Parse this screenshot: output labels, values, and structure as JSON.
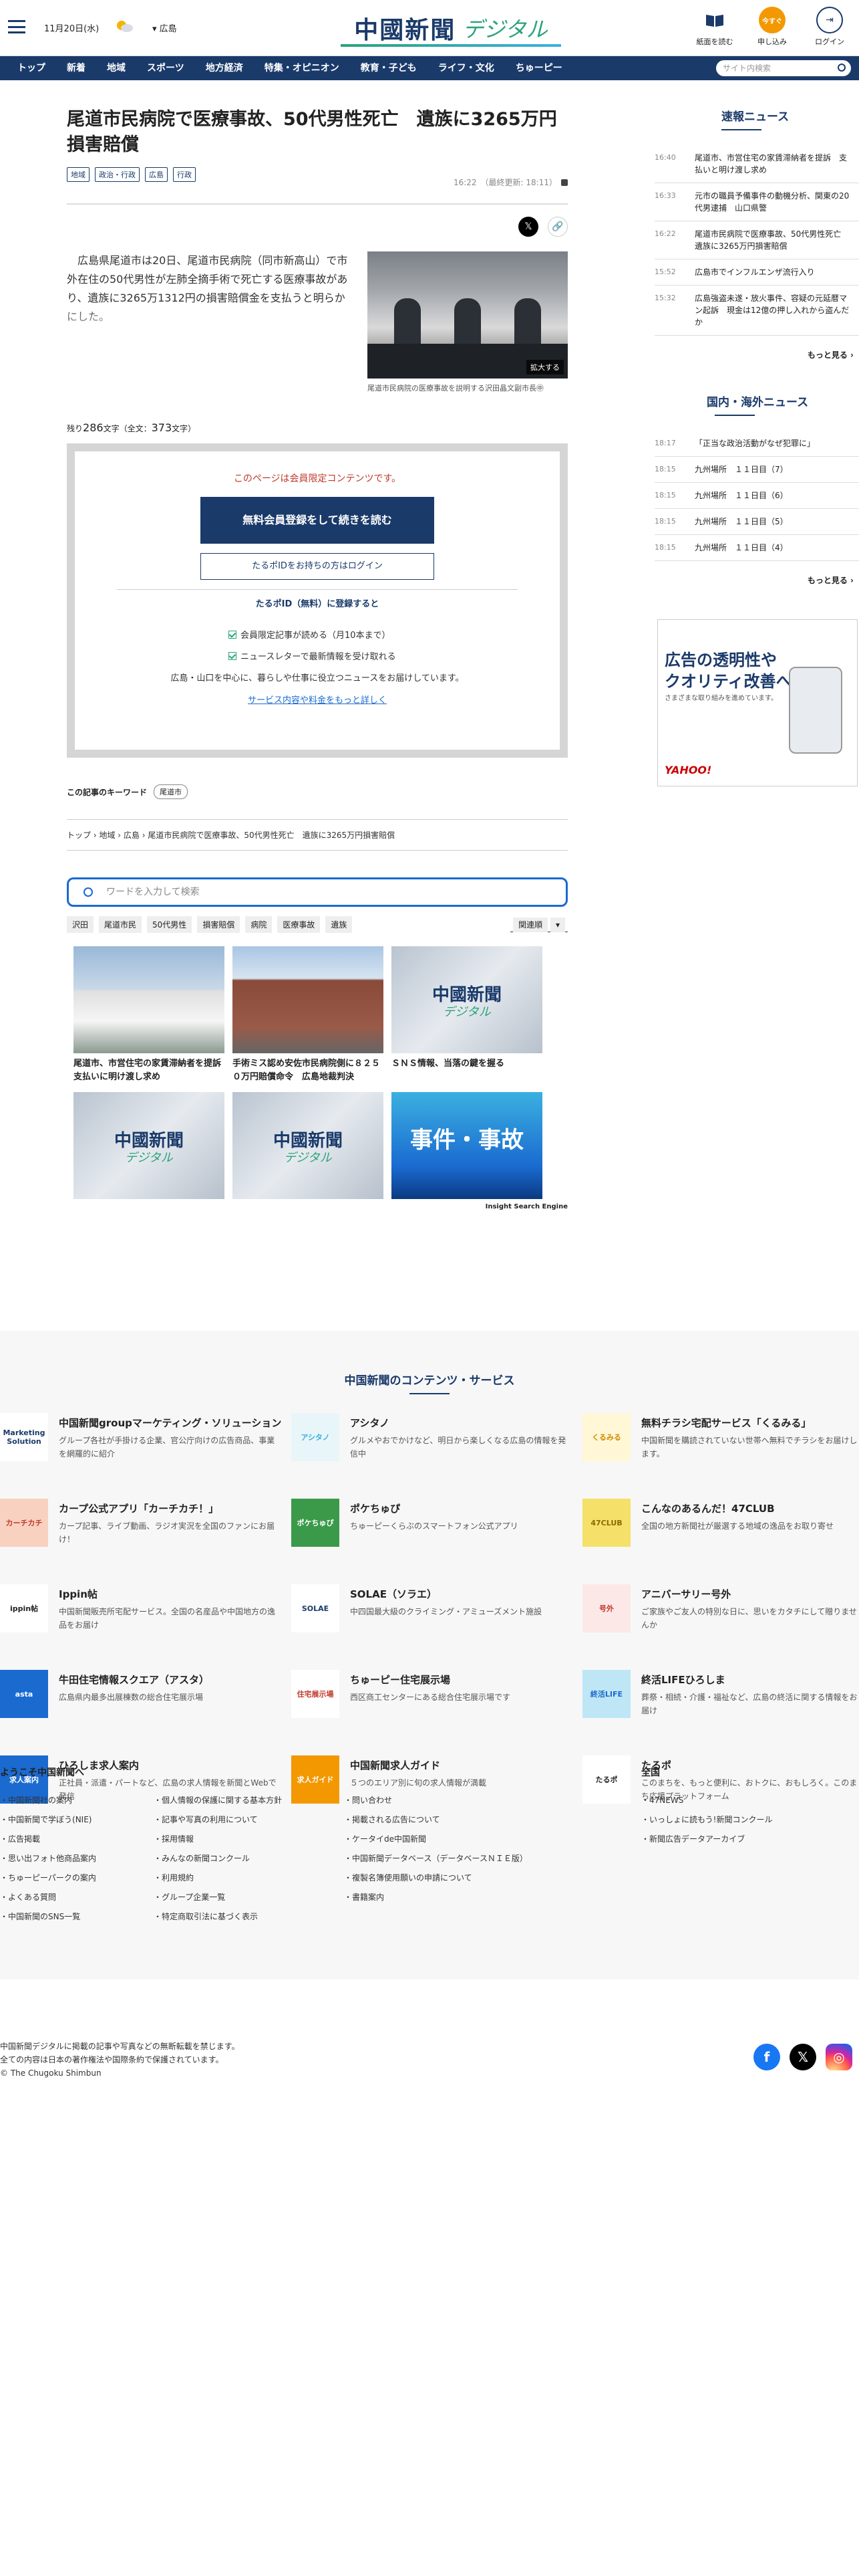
{
  "header": {
    "date": "11月20日(水)",
    "region": "広島",
    "logo_main": "中國新聞",
    "logo_sub": "デジタル",
    "buttons": [
      {
        "label": "紙面を読む",
        "icon": "newspaper-icon"
      },
      {
        "label": "申し込み",
        "icon": "apply-icon",
        "badge": "今すぐ"
      },
      {
        "label": "ログイン",
        "icon": "login-icon"
      }
    ]
  },
  "nav": {
    "items": [
      "トップ",
      "新着",
      "地域",
      "スポーツ",
      "地方経済",
      "特集・オピニオン",
      "教育・子ども",
      "ライフ・文化",
      "ちゅーピー"
    ],
    "search_placeholder": "サイト内検索"
  },
  "article": {
    "title": "尾道市民病院で医療事故、50代男性死亡　遺族に3265万円損害賠償",
    "tags": [
      "地域",
      "政治・行政",
      "広島",
      "行政"
    ],
    "time": "16:22",
    "updated": "（最終更新: 18:11）",
    "lead": "　広島県尾道市は20日、尾道市民病院（同市新高山）で市外在住の50代男性が左肺全摘手術で死亡する医療事故があり、遺族に3265万1312円の損害賠償金を支払うと明らかにした。",
    "photo_enlarge": "拡大する",
    "photo_caption": "尾道市民病院の医療事故を説明する沢田晶文副市長㊥",
    "remain_label": "残り",
    "remain_count": "286",
    "remain_unit": "文字（全文：",
    "total_count": "373",
    "total_unit": "文字）"
  },
  "paywall": {
    "notice": "このページは会員限定コンテンツです。",
    "register_button": "無料会員登録をして続きを読む",
    "login_button": "たるポIDをお持ちの方はログイン",
    "subtitle": "たるポID（無料）に登録すると",
    "benefits": [
      "会員限定記事が読める（月10本まで）",
      "ニュースレターで最新情報を受け取れる"
    ],
    "desc": "広島・山口を中心に、暮らしや仕事に役立つニュースをお届けしています。",
    "more_link": "サービス内容や料金をもっと詳しく"
  },
  "keywords": {
    "label": "この記事のキーワード",
    "items": [
      "尾道市"
    ]
  },
  "breadcrumb": [
    "トップ",
    "地域",
    "広島",
    "尾道市民病院で医療事故、50代男性死亡　遺族に3265万円損害賠償"
  ],
  "search": {
    "placeholder": "ワードを入力して検索",
    "keywords": [
      "沢田",
      "尾道市民",
      "50代男性",
      "損害賠償",
      "病院",
      "医療事故",
      "遺族"
    ],
    "sort": "関連順",
    "results": [
      {
        "title": "尾道市、市営住宅の家賃滞納者を提訴　支払いに明け渡し求め",
        "thumb": "building"
      },
      {
        "title": "手術ミス認め安佐市民病院側に８２５０万円賠償命令　広島地裁判決",
        "thumb": "hospital"
      },
      {
        "title": "ＳＮＳ情報、当落の鍵を握る",
        "thumb": "logo"
      },
      {
        "title": "",
        "thumb": "logo"
      },
      {
        "title": "",
        "thumb": "logo"
      },
      {
        "title": "",
        "thumb": "jiken"
      }
    ],
    "logo_main": "中國新聞",
    "logo_sub": "デジタル",
    "jiken": "事件・事故",
    "engine": "Insight Search Engine"
  },
  "sidebar": {
    "breaking": {
      "title": "速報ニュース",
      "items": [
        {
          "time": "16:40",
          "text": "尾道市、市営住宅の家賃滞納者を提訴　支払いと明け渡し求め"
        },
        {
          "time": "16:33",
          "text": "元市の職員予備事件の動機分析、関東の20代男逮捕　山口県警"
        },
        {
          "time": "16:22",
          "text": "尾道市民病院で医療事故、50代男性死亡　遺族に3265万円損害賠償"
        },
        {
          "time": "15:52",
          "text": "広島市でインフルエンザ流行入り"
        },
        {
          "time": "15:32",
          "text": "広島強盗未遂・放火事件、容疑の元延暦マン起訴　現金は12億の押し入れから盗んだか"
        }
      ],
      "more": "もっと見る ›"
    },
    "national": {
      "title": "国内・海外ニュース",
      "items": [
        {
          "time": "18:17",
          "text": "「正当な政治活動がなぜ犯罪に」"
        },
        {
          "time": "18:15",
          "text": "九州場所　１１日目（7）"
        },
        {
          "time": "18:15",
          "text": "九州場所　１１日目（6）"
        },
        {
          "time": "18:15",
          "text": "九州場所　１１日目（5）"
        },
        {
          "time": "18:15",
          "text": "九州場所　１１日目（4）"
        }
      ],
      "more": "もっと見る ›"
    },
    "ad": {
      "line1": "広告の透明性や",
      "line2": "クオリティ改善への",
      "line3": "さまざまな取り組みを進めています。",
      "brand": "YAHOO!"
    }
  },
  "services": {
    "title": "中国新聞のコンテンツ・サービス",
    "items": [
      {
        "name": "中国新聞groupマーケティング・ソリューション",
        "desc": "グループ各社が手掛ける企業、官公庁向けの広告商品、事業を網羅的に紹介",
        "icon": "Marketing Solution",
        "bg": "#ffffff",
        "fg": "#1a3a6a"
      },
      {
        "name": "アシタノ",
        "desc": "グルメやおでかけなど、明日から楽しくなる広島の情報を発信中",
        "icon": "アシタノ",
        "bg": "#e8f6fa",
        "fg": "#3bb0e0"
      },
      {
        "name": "無料チラシ宅配サービス「くるみる」",
        "desc": "中国新聞を購読されていない世帯へ無料でチラシをお届けします。",
        "icon": "くるみる",
        "bg": "#fff7d6",
        "fg": "#d08a00"
      },
      {
        "name": "カープ公式アプリ「カーチカチ！」",
        "desc": "カープ記事、ライブ動画、ラジオ実況を全国のファンにお届け！",
        "icon": "カーチカチ",
        "bg": "#f9d1c0",
        "fg": "#c0392b"
      },
      {
        "name": "ポケちゅぴ",
        "desc": "ちゅーピーくらぶのスマートフォン公式アプリ",
        "icon": "ポケちゅぴ",
        "bg": "#3a9a4a",
        "fg": "#ffffff"
      },
      {
        "name": "こんなのあるんだ！47CLUB",
        "desc": "全国の地方新聞社が厳選する地域の逸品をお取り寄せ",
        "icon": "47CLUB",
        "bg": "#f5e06a",
        "fg": "#8a6a00"
      },
      {
        "name": "Ippin帖",
        "desc": "中国新聞販売所宅配サービス。全国の名産品や中国地方の逸品をお届け",
        "icon": "ippin帖",
        "bg": "#ffffff",
        "fg": "#222222"
      },
      {
        "name": "SOLAE（ソラエ）",
        "desc": "中四国最大級のクライミング・アミューズメント施設",
        "icon": "SOLAE",
        "bg": "#ffffff",
        "fg": "#1a3a6a"
      },
      {
        "name": "アニバーサリー号外",
        "desc": "ご家族やご友人の特別な日に、思いをカタチにして贈りませんか",
        "icon": "号外",
        "bg": "#fde8e8",
        "fg": "#c0392b"
      },
      {
        "name": "牛田住宅情報スクエア（アスタ）",
        "desc": "広島県内最多出展棟数の総合住宅展示場",
        "icon": "asta",
        "bg": "#1a6ad0",
        "fg": "#ffffff"
      },
      {
        "name": "ちゅーピー住宅展示場",
        "desc": "西区商工センターにある総合住宅展示場です",
        "icon": "住宅展示場",
        "bg": "#ffffff",
        "fg": "#c0392b"
      },
      {
        "name": "終活LIFEひろしま",
        "desc": "葬祭・相続・介護・福祉など、広島の終活に関する情報をお届け",
        "icon": "終活LIFE",
        "bg": "#bfe6f5",
        "fg": "#1a6ad0"
      },
      {
        "name": "ひろしま求人案内",
        "desc": "正社員・派遣・パートなど、広島の求人情報を新聞とWebで発信",
        "icon": "求人案内",
        "bg": "#1a6ad0",
        "fg": "#ffffff"
      },
      {
        "name": "中国新聞求人ガイド",
        "desc": "５つのエリア別に旬の求人情報が満載",
        "icon": "求人ガイド",
        "bg": "#f39800",
        "fg": "#ffffff"
      },
      {
        "name": "たるポ",
        "desc": "このまちを、もっと便利に、おトクに、おもしろく。このまち応援プラットフォーム",
        "icon": "たるポ",
        "bg": "#ffffff",
        "fg": "#222222"
      }
    ]
  },
  "footer": {
    "welcome_title": "ようこそ中国新聞へ",
    "national_title": "全国",
    "col1": [
      "中国新聞社の案内",
      "中国新聞で学ぼう(NIE)",
      "広告掲載",
      "思い出フォト他商品案内",
      "ちゅーピーパークの案内",
      "よくある質問",
      "中国新聞のSNS一覧"
    ],
    "col2": [
      "個人情報の保護に関する基本方針",
      "記事や写真の利用について",
      "採用情報",
      "みんなの新聞コンクール",
      "利用規約",
      "グループ企業一覧",
      "特定商取引法に基づく表示"
    ],
    "col3": [
      "問い合わせ",
      "掲載される広告について",
      "ケータイde中国新聞",
      "中国新聞データベース（データベースＮＩＥ版）",
      "複製名簿使用願いの申請について",
      "書籍案内"
    ],
    "col4": [
      "47NEWS",
      "いっしょに読もう!新聞コンクール",
      "新聞広告データアーカイブ"
    ],
    "notice1": "中国新聞デジタルに掲載の記事や写真などの無断転載を禁じます。",
    "notice2": "全ての内容は日本の著作権法や国際条約で保護されています。",
    "copyright": "© The Chugoku Shimbun",
    "social": [
      "f",
      "𝕏",
      "◎"
    ]
  }
}
